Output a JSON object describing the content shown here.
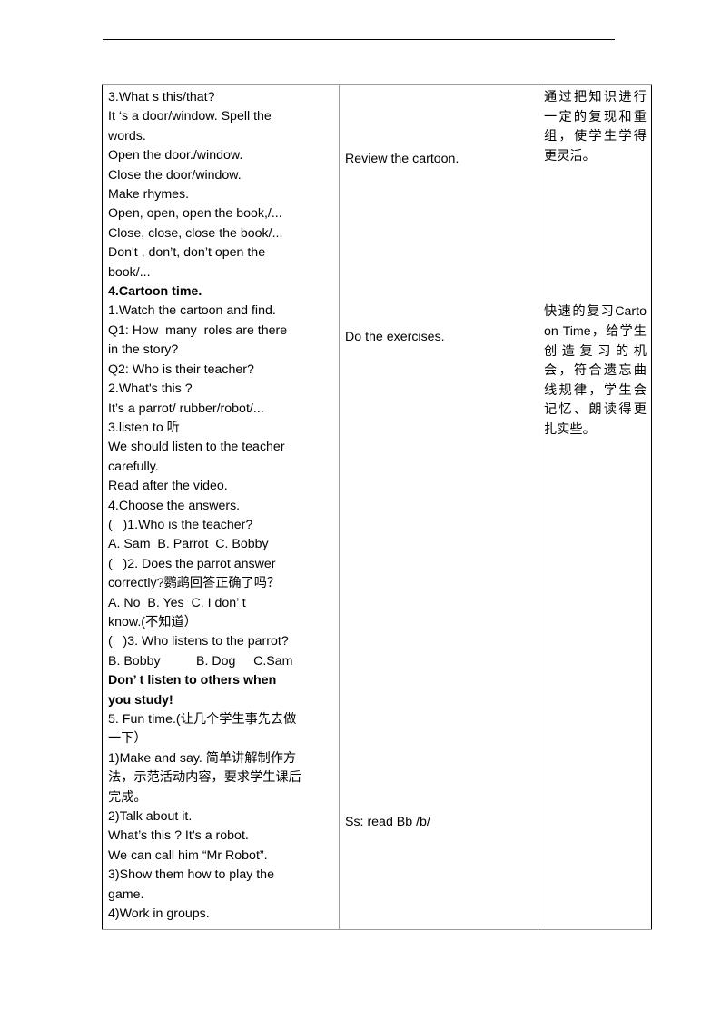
{
  "document": {
    "type": "lesson-plan-table",
    "header_rule": true
  },
  "table": {
    "columns": [
      {
        "name": "teaching-steps"
      },
      {
        "name": "teaching-notes"
      },
      {
        "name": "design-purpose"
      }
    ],
    "steps_column": {
      "lines": [
        {
          "text": "3.What s this/that?",
          "bold": false
        },
        {
          "text": "It ‘s a door/window. Spell the",
          "bold": false
        },
        {
          "text": "words.",
          "bold": false
        },
        {
          "text": "Open the door./window.",
          "bold": false
        },
        {
          "text": "Close the door/window.",
          "bold": false
        },
        {
          "text": "Make rhymes.",
          "bold": false
        },
        {
          "text": "Open, open, open the book,/...",
          "bold": false
        },
        {
          "text": "Close, close, close the book/...",
          "bold": false
        },
        {
          "text": "Don't , don’t, don’t open the",
          "bold": false
        },
        {
          "text": "book/...",
          "bold": false
        },
        {
          "text": "4.Cartoon time.",
          "bold": true
        },
        {
          "text": "1.Watch the cartoon and find.",
          "bold": false
        },
        {
          "text": "Q1: How  many  roles are there",
          "bold": false
        },
        {
          "text": "in the story?",
          "bold": false
        },
        {
          "text": "Q2: Who is their teacher?",
          "bold": false
        },
        {
          "text": "2.What's this ?",
          "bold": false
        },
        {
          "text": "It’s a parrot/ rubber/robot/...",
          "bold": false
        },
        {
          "text": "3.listen to 听",
          "bold": false
        },
        {
          "text": "We should listen to the teacher",
          "bold": false
        },
        {
          "text": "carefully.",
          "bold": false
        },
        {
          "text": "Read after the video.",
          "bold": false
        },
        {
          "text": "4.Choose the answers.",
          "bold": false
        },
        {
          "text": "(   )1.Who is the teacher?",
          "bold": false
        },
        {
          "text": "A. Sam  B. Parrot  C. Bobby",
          "bold": false
        },
        {
          "text": "(   )2. Does the parrot answer",
          "bold": false
        },
        {
          "text": "correctly?鹦鹉回答正确了吗？",
          "bold": false
        },
        {
          "text": "A. No  B. Yes  C. I don’ t",
          "bold": false
        },
        {
          "text": "know.(不知道）",
          "bold": false
        },
        {
          "text": "(   )3. Who listens to the parrot?",
          "bold": false
        },
        {
          "text": "B. Bobby          B. Dog     C.Sam",
          "bold": false
        },
        {
          "text": "Don’ t listen to others when",
          "bold": true
        },
        {
          "text": "you study!",
          "bold": true
        },
        {
          "text": "5. Fun time.(让几个学生事先去做",
          "bold": false
        },
        {
          "text": "一下）",
          "bold": false
        },
        {
          "text": "1)Make and say. 简单讲解制作方",
          "bold": false
        },
        {
          "text": "法，示范活动内容，要求学生课后",
          "bold": false
        },
        {
          "text": "完成。",
          "bold": false
        },
        {
          "text": "2)Talk about it.",
          "bold": false
        },
        {
          "text": "What’s this ? It’s a robot.",
          "bold": false
        },
        {
          "text": "We can call him “Mr Robot”.",
          "bold": false
        },
        {
          "text": "3)Show them how to play the",
          "bold": false
        },
        {
          "text": "game.",
          "bold": false
        },
        {
          "text": "4)Work in groups.",
          "bold": false
        }
      ]
    },
    "notes_column": {
      "entries": [
        {
          "text": "Review the cartoon."
        },
        {
          "text": "Do the exercises."
        },
        {
          "text": "Ss: read Bb /b/"
        }
      ]
    },
    "purpose_column": {
      "paragraphs": [
        {
          "text": "通过把知识进行一定的复现和重组，使学生学得更灵活。"
        },
        {
          "text": "快速的复习Cartoon Time，给学生创造复习的机会，符合遗忘曲线规律，学生会记忆、朗读得更扎实些。"
        }
      ]
    }
  }
}
